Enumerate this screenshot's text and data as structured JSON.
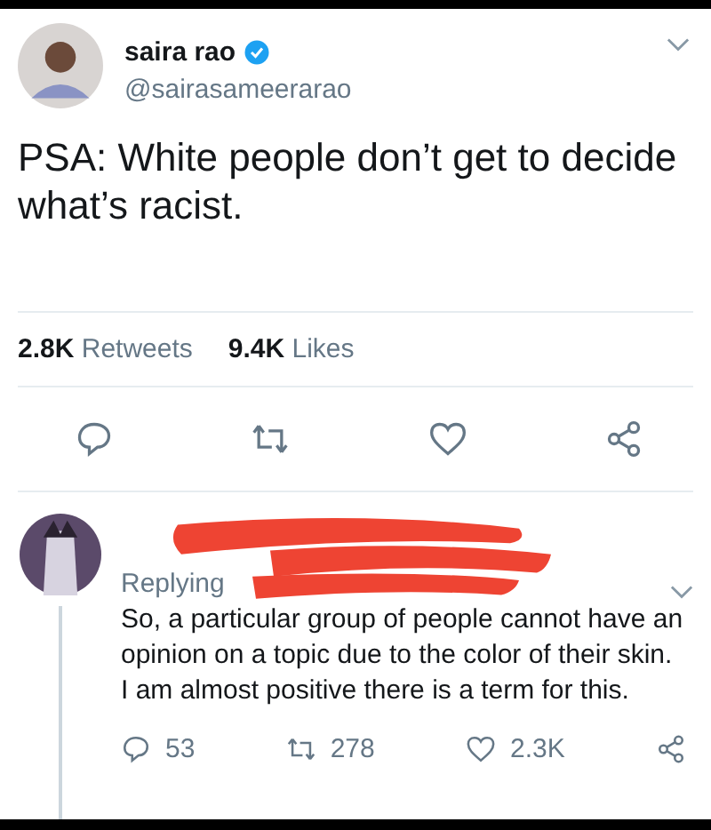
{
  "tweet": {
    "name": "saira rao",
    "verified": true,
    "handle": "@sairasameerarao",
    "text": "PSA: White people don’t get to decide what’s racist.",
    "stats": [
      {
        "count": "2.8K",
        "label": "Retweets"
      },
      {
        "count": "9.4K",
        "label": "Likes"
      }
    ],
    "actions": [
      {
        "kind": "reply"
      },
      {
        "kind": "retweet"
      },
      {
        "kind": "like"
      },
      {
        "kind": "share"
      }
    ]
  },
  "reply": {
    "replying": "Replying",
    "text": "So, a particular group of people cannot have an opinion on a topic due to the color of their skin. I am almost positive there is a term for this.",
    "actions": [
      {
        "kind": "reply",
        "count": "53"
      },
      {
        "kind": "retweet",
        "count": "278"
      },
      {
        "kind": "like",
        "count": "2.3K"
      },
      {
        "kind": "share"
      }
    ]
  }
}
